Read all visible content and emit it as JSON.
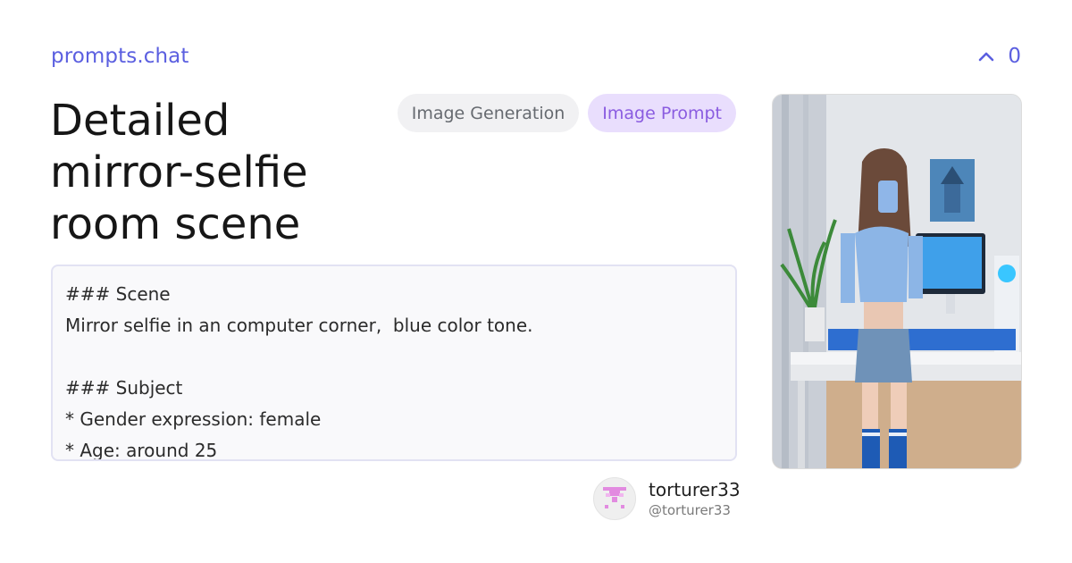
{
  "brand": "prompts.chat",
  "votes": {
    "count": "0"
  },
  "title": "Detailed mirror-selfie room scene",
  "tags": [
    {
      "label": "Image Generation"
    },
    {
      "label": "Image Prompt"
    }
  ],
  "prompt_lines": [
    "### Scene",
    "Mirror selfie in an computer corner,  blue color tone.",
    "",
    "### Subject",
    "* Gender expression: female",
    "* Age: around 25"
  ],
  "author": {
    "name": "torturer33",
    "handle": "@torturer33"
  },
  "colors": {
    "accent": "#5b5fe0",
    "tag_purple_bg": "#e9defd",
    "tag_purple_text": "#8a5ce0"
  },
  "icons": {
    "votes": "chevron-up-icon"
  }
}
